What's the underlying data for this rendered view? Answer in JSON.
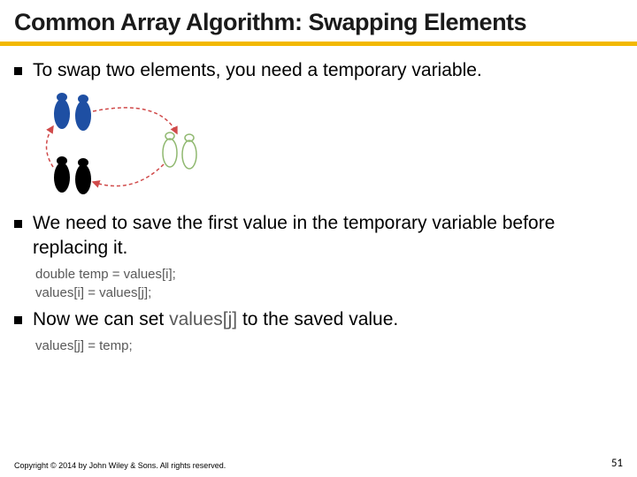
{
  "title": "Common Array Algorithm:  Swapping Elements",
  "bullets": [
    {
      "text": "To swap two elements, you need a temporary variable."
    },
    {
      "text": "We need to save the first value in the temporary variable before replacing it."
    },
    {
      "text_pre": "Now we can set ",
      "code": "values[j]",
      "text_post": " to the saved value."
    }
  ],
  "code_block_1": [
    "double temp = values[i];",
    "values[i] = values[j];"
  ],
  "code_block_2": [
    "values[j] = temp;"
  ],
  "footer": {
    "copyright": "Copyright © 2014 by John Wiley & Sons. All rights reserved.",
    "page": "51"
  },
  "diagram": {
    "description": "footprint-swap-illustration",
    "colors": {
      "top": "#1e4fa3",
      "bottom": "#000000",
      "empty": "#9fbf7f",
      "arrow": "#d04a4a"
    }
  }
}
